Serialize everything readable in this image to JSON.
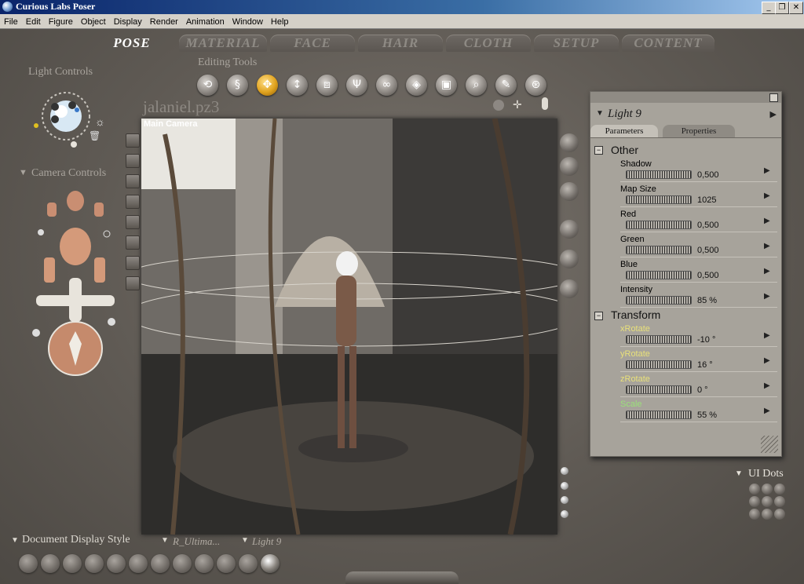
{
  "window": {
    "title": "Curious Labs Poser",
    "min": "_",
    "max": "❐",
    "close": "✕"
  },
  "menu": [
    "File",
    "Edit",
    "Figure",
    "Object",
    "Display",
    "Render",
    "Animation",
    "Window",
    "Help"
  ],
  "tabs": [
    "POSE",
    "MATERIAL",
    "FACE",
    "HAIR",
    "CLOTH",
    "SETUP",
    "CONTENT"
  ],
  "labels": {
    "light_controls": "Light Controls",
    "editing_tools": "Editing Tools",
    "camera_controls": "Camera Controls",
    "ui_dots": "UI Dots",
    "document_display_style": "Document Display Style",
    "render_style": "R_Ultima...",
    "selected_light": "Light 9"
  },
  "document": {
    "title": "jalaniel.pz3",
    "camera": "Main Camera"
  },
  "panel": {
    "title": "Light 9",
    "tabs": [
      "Parameters",
      "Properties"
    ],
    "sections": [
      {
        "name": "Other",
        "params": [
          {
            "label": "Shadow",
            "value": "0,500"
          },
          {
            "label": "Map Size",
            "value": "1025"
          },
          {
            "label": "Red",
            "value": "0,500"
          },
          {
            "label": "Green",
            "value": "0,500"
          },
          {
            "label": "Blue",
            "value": "0,500"
          },
          {
            "label": "Intensity",
            "value": "85 %"
          }
        ]
      },
      {
        "name": "Transform",
        "params": [
          {
            "label": "xRotate",
            "value": "-10 °",
            "color": "#e8e07a"
          },
          {
            "label": "yRotate",
            "value": "16 °",
            "color": "#e8e07a"
          },
          {
            "label": "zRotate",
            "value": "0 °",
            "color": "#e8e07a"
          },
          {
            "label": "Scale",
            "value": "55 %",
            "color": "#9be07a"
          }
        ]
      }
    ]
  },
  "icons": {
    "editing_tools": [
      "rotate-icon",
      "twist-icon",
      "translate-icon",
      "translate-in-out-icon",
      "scale-icon",
      "taper-icon",
      "chain-break-icon",
      "color-icon",
      "grouping-icon",
      "view-magnifier-icon",
      "morphing-tool-icon",
      "direct-manipulation-icon"
    ]
  }
}
